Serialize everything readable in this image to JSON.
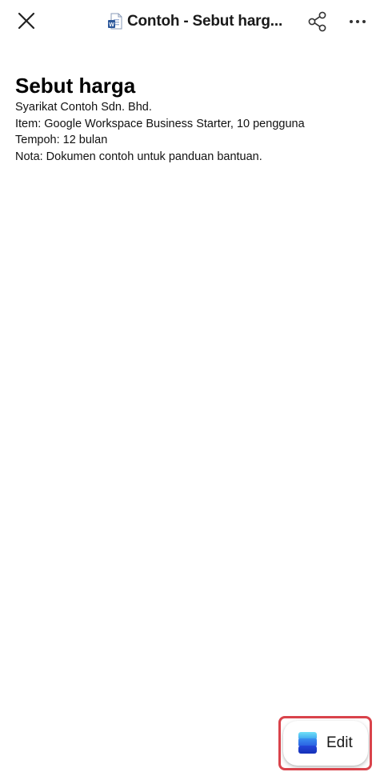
{
  "header": {
    "close_icon": "close-icon",
    "doc_icon": "word-document-icon",
    "title": "Contoh - Sebut harg...",
    "share_icon": "share-icon",
    "more_icon": "more-horizontal-icon"
  },
  "document": {
    "heading": "Sebut harga",
    "lines": [
      "Syarikat Contoh Sdn. Bhd.",
      "Item: Google Workspace Business Starter, 10 pengguna",
      "Tempoh: 12 bulan",
      "Nota: Dokumen contoh untuk panduan bantuan."
    ]
  },
  "edit_button": {
    "label": "Edit",
    "icon": "edit-app-icon",
    "highlight_color": "#d9434b"
  },
  "colors": {
    "word_blue": "#2b579a",
    "edit_gradient_top": "#5fd3f3",
    "edit_gradient_bottom": "#1a3fd6"
  }
}
